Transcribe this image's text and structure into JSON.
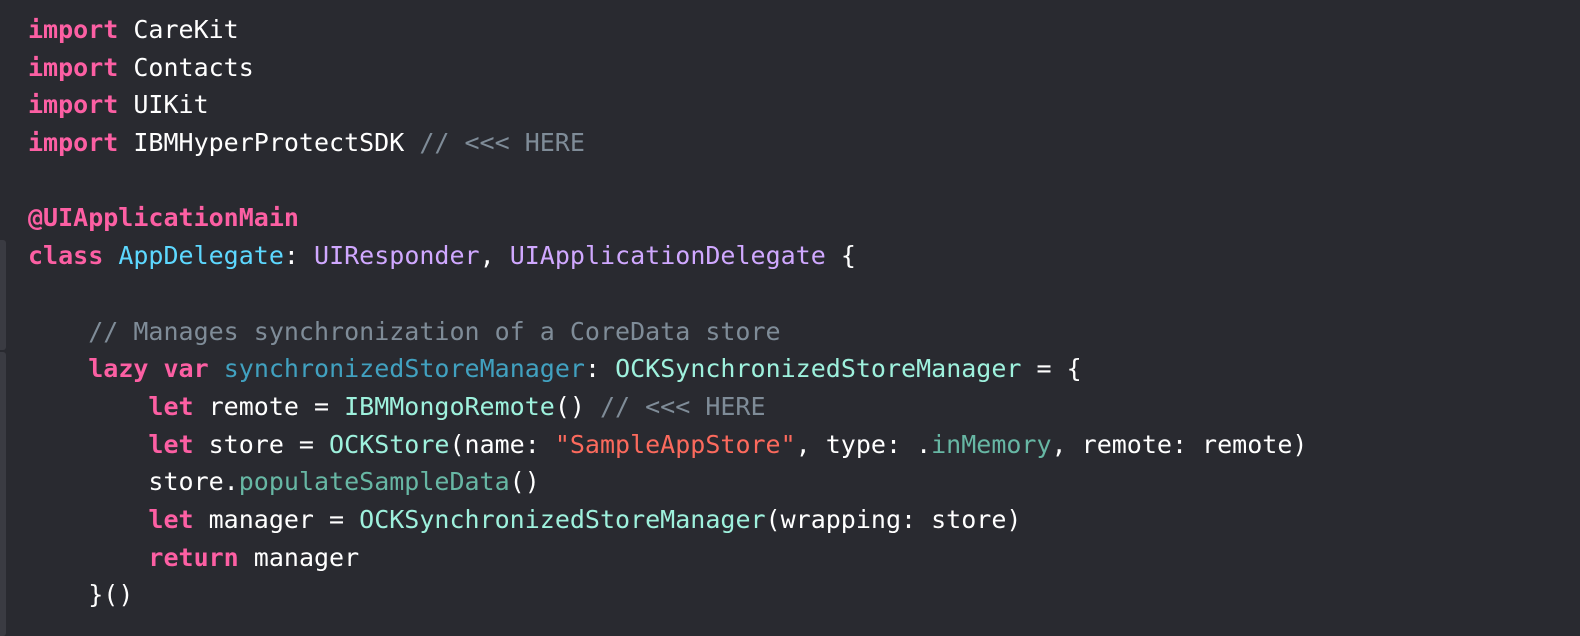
{
  "editor": {
    "colors": {
      "background": "#292a30",
      "keyword": "#fc5fa3",
      "comment": "#7f8c98",
      "string": "#fc6a5d",
      "declared_type": "#5dd8ff",
      "declared_var": "#41a1c0",
      "system_type": "#d0a8ff",
      "project_type": "#9ef1dd",
      "project_member": "#67b7a4",
      "plain": "#ffffff"
    },
    "lines": [
      {
        "id": "l1",
        "indent": "",
        "tokens": [
          {
            "t": "import",
            "k": "kw"
          },
          {
            "t": " CareKit",
            "k": "plain"
          }
        ]
      },
      {
        "id": "l2",
        "indent": "",
        "tokens": [
          {
            "t": "import",
            "k": "kw"
          },
          {
            "t": " Contacts",
            "k": "plain"
          }
        ]
      },
      {
        "id": "l3",
        "indent": "",
        "tokens": [
          {
            "t": "import",
            "k": "kw"
          },
          {
            "t": " UIKit",
            "k": "plain"
          }
        ]
      },
      {
        "id": "l4",
        "indent": "",
        "tokens": [
          {
            "t": "import",
            "k": "kw"
          },
          {
            "t": " IBMHyperProtectSDK ",
            "k": "plain"
          },
          {
            "t": "// <<< HERE",
            "k": "cmt"
          }
        ]
      },
      {
        "id": "l5",
        "indent": "",
        "tokens": []
      },
      {
        "id": "l6",
        "indent": "",
        "tokens": [
          {
            "t": "@UIApplicationMain",
            "k": "attr"
          }
        ]
      },
      {
        "id": "l7",
        "indent": "",
        "tokens": [
          {
            "t": "class",
            "k": "kw"
          },
          {
            "t": " ",
            "k": "plain"
          },
          {
            "t": "AppDelegate",
            "k": "decl-type"
          },
          {
            "t": ": ",
            "k": "plain"
          },
          {
            "t": "UIResponder",
            "k": "sys-type"
          },
          {
            "t": ", ",
            "k": "plain"
          },
          {
            "t": "UIApplicationDelegate",
            "k": "sys-type"
          },
          {
            "t": " {",
            "k": "plain"
          }
        ]
      },
      {
        "id": "l8",
        "indent": "",
        "tokens": []
      },
      {
        "id": "l9",
        "indent": "    ",
        "tokens": [
          {
            "t": "// Manages synchronization of a CoreData store",
            "k": "cmt"
          }
        ]
      },
      {
        "id": "l10",
        "indent": "    ",
        "tokens": [
          {
            "t": "lazy",
            "k": "kw"
          },
          {
            "t": " ",
            "k": "plain"
          },
          {
            "t": "var",
            "k": "kw"
          },
          {
            "t": " ",
            "k": "plain"
          },
          {
            "t": "synchronizedStoreManager",
            "k": "decl-var"
          },
          {
            "t": ": ",
            "k": "plain"
          },
          {
            "t": "OCKSynchronizedStoreManager",
            "k": "proj-type"
          },
          {
            "t": " = {",
            "k": "plain"
          }
        ]
      },
      {
        "id": "l11",
        "indent": "        ",
        "tokens": [
          {
            "t": "let",
            "k": "kw"
          },
          {
            "t": " remote = ",
            "k": "plain"
          },
          {
            "t": "IBMMongoRemote",
            "k": "proj-type"
          },
          {
            "t": "() ",
            "k": "plain"
          },
          {
            "t": "// <<< HERE",
            "k": "cmt"
          }
        ]
      },
      {
        "id": "l12",
        "indent": "        ",
        "tokens": [
          {
            "t": "let",
            "k": "kw"
          },
          {
            "t": " store = ",
            "k": "plain"
          },
          {
            "t": "OCKStore",
            "k": "proj-type"
          },
          {
            "t": "(name: ",
            "k": "plain"
          },
          {
            "t": "\"SampleAppStore\"",
            "k": "str"
          },
          {
            "t": ", type: .",
            "k": "plain"
          },
          {
            "t": "inMemory",
            "k": "proj-func"
          },
          {
            "t": ", remote: remote)",
            "k": "plain"
          }
        ]
      },
      {
        "id": "l13",
        "indent": "        ",
        "tokens": [
          {
            "t": "store.",
            "k": "plain"
          },
          {
            "t": "populateSampleData",
            "k": "proj-func"
          },
          {
            "t": "()",
            "k": "plain"
          }
        ]
      },
      {
        "id": "l14",
        "indent": "        ",
        "tokens": [
          {
            "t": "let",
            "k": "kw"
          },
          {
            "t": " manager = ",
            "k": "plain"
          },
          {
            "t": "OCKSynchronizedStoreManager",
            "k": "proj-type"
          },
          {
            "t": "(wrapping: store)",
            "k": "plain"
          }
        ]
      },
      {
        "id": "l15",
        "indent": "        ",
        "tokens": [
          {
            "t": "return",
            "k": "kw"
          },
          {
            "t": " manager",
            "k": "plain"
          }
        ]
      },
      {
        "id": "l16",
        "indent": "    ",
        "tokens": [
          {
            "t": "}()",
            "k": "plain"
          }
        ]
      }
    ]
  }
}
